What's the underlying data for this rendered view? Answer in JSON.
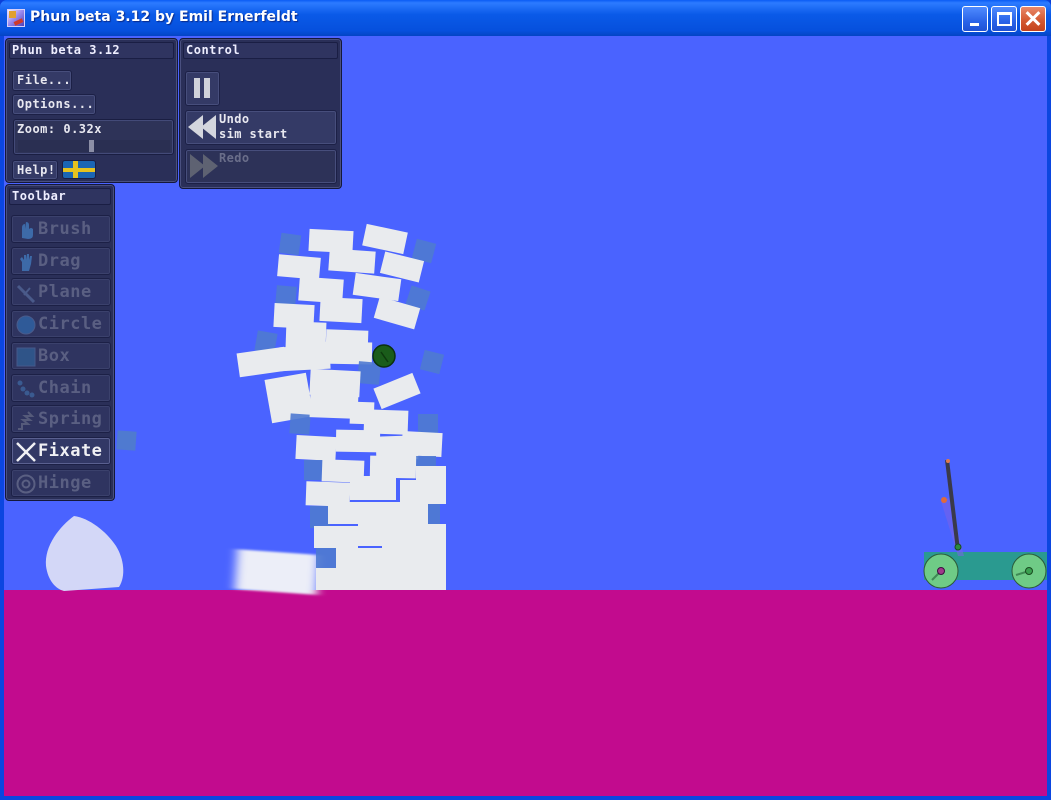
{
  "window": {
    "title": "Phun beta 3.12 by Emil Ernerfeldt",
    "buttons": {
      "minimize": "minimize",
      "maximize": "maximize",
      "close": "close"
    }
  },
  "colors": {
    "sky": "#4a63ff",
    "ground": "#c20b8e",
    "box_light": "#e9ebee",
    "box_dark": "#4f7ad0",
    "ball": "#1a5c1a",
    "cart_body": "#2a9a90",
    "wheel": "#6fcb86",
    "pole": "#3a3a4a",
    "blob": "#d3d7f7"
  },
  "main_panel": {
    "title": "Phun beta 3.12",
    "file_label": "File...",
    "options_label": "Options...",
    "zoom_label": "Zoom: 0.32x",
    "zoom_value": 0.32,
    "zoom_slider_fraction": 0.48,
    "help_label": "Help!",
    "language_flag": "sweden-flag"
  },
  "control_panel": {
    "title": "Control",
    "pause_icon": "pause-icon",
    "undo_label_line1": "Undo",
    "undo_label_line2": "sim start",
    "redo_label": "Redo"
  },
  "toolbar": {
    "title": "Toolbar",
    "items": [
      {
        "label": "Brush",
        "icon": "hand-icon",
        "active": false
      },
      {
        "label": "Drag",
        "icon": "grab-hand-icon",
        "active": false
      },
      {
        "label": "Plane",
        "icon": "plane-icon",
        "active": false
      },
      {
        "label": "Circle",
        "icon": "circle-icon",
        "active": false
      },
      {
        "label": "Box",
        "icon": "box-icon",
        "active": false
      },
      {
        "label": "Chain",
        "icon": "chain-icon",
        "active": false
      },
      {
        "label": "Spring",
        "icon": "spring-icon",
        "active": false
      },
      {
        "label": "Fixate",
        "icon": "fixate-x-icon",
        "active": true
      },
      {
        "label": "Hinge",
        "icon": "hinge-icon",
        "active": false
      }
    ]
  }
}
